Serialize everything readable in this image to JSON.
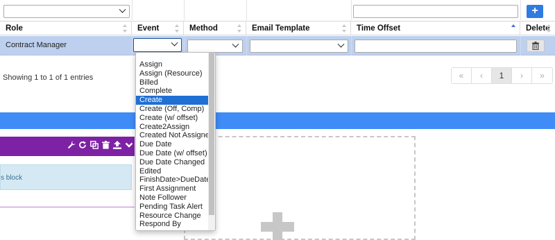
{
  "table": {
    "headers": [
      {
        "label": "Role"
      },
      {
        "label": "Event"
      },
      {
        "label": "Method"
      },
      {
        "label": "Email Template"
      },
      {
        "label": "Time Offset"
      },
      {
        "label": "Delete"
      }
    ],
    "rows": [
      {
        "role": "Contract Manager",
        "event": "",
        "method": "",
        "email_template": "",
        "time_offset": ""
      }
    ]
  },
  "info_text": "Showing 1 to 1 of 1 entries",
  "pagination": {
    "first": "«",
    "prev": "‹",
    "page": "1",
    "next": "›",
    "last": "»"
  },
  "add_button": "+",
  "info_block_text": "s block",
  "dropdown": {
    "options": [
      "Assign",
      "Assign (Resource)",
      "Billed",
      "Complete",
      "Create",
      "Create (Off, Comp)",
      "Create (w/ offset)",
      "Create2Assign",
      "Created Not Assigned",
      "Due Date",
      "Due Date (w/ offset)",
      "Due Date Changed",
      "Edited",
      "FinishDate>DueDate",
      "First Assignment",
      "Note Follower",
      "Pending Task Alert",
      "Resource Change",
      "Respond By"
    ],
    "highlighted": "Create"
  },
  "colors": {
    "blue_bar": "#3f8cf6",
    "purple_bar": "#7e22a5",
    "selected_row": "#bdd0ef",
    "dropdown_highlight": "#1f6fd5",
    "add_button": "#2f7be0"
  }
}
